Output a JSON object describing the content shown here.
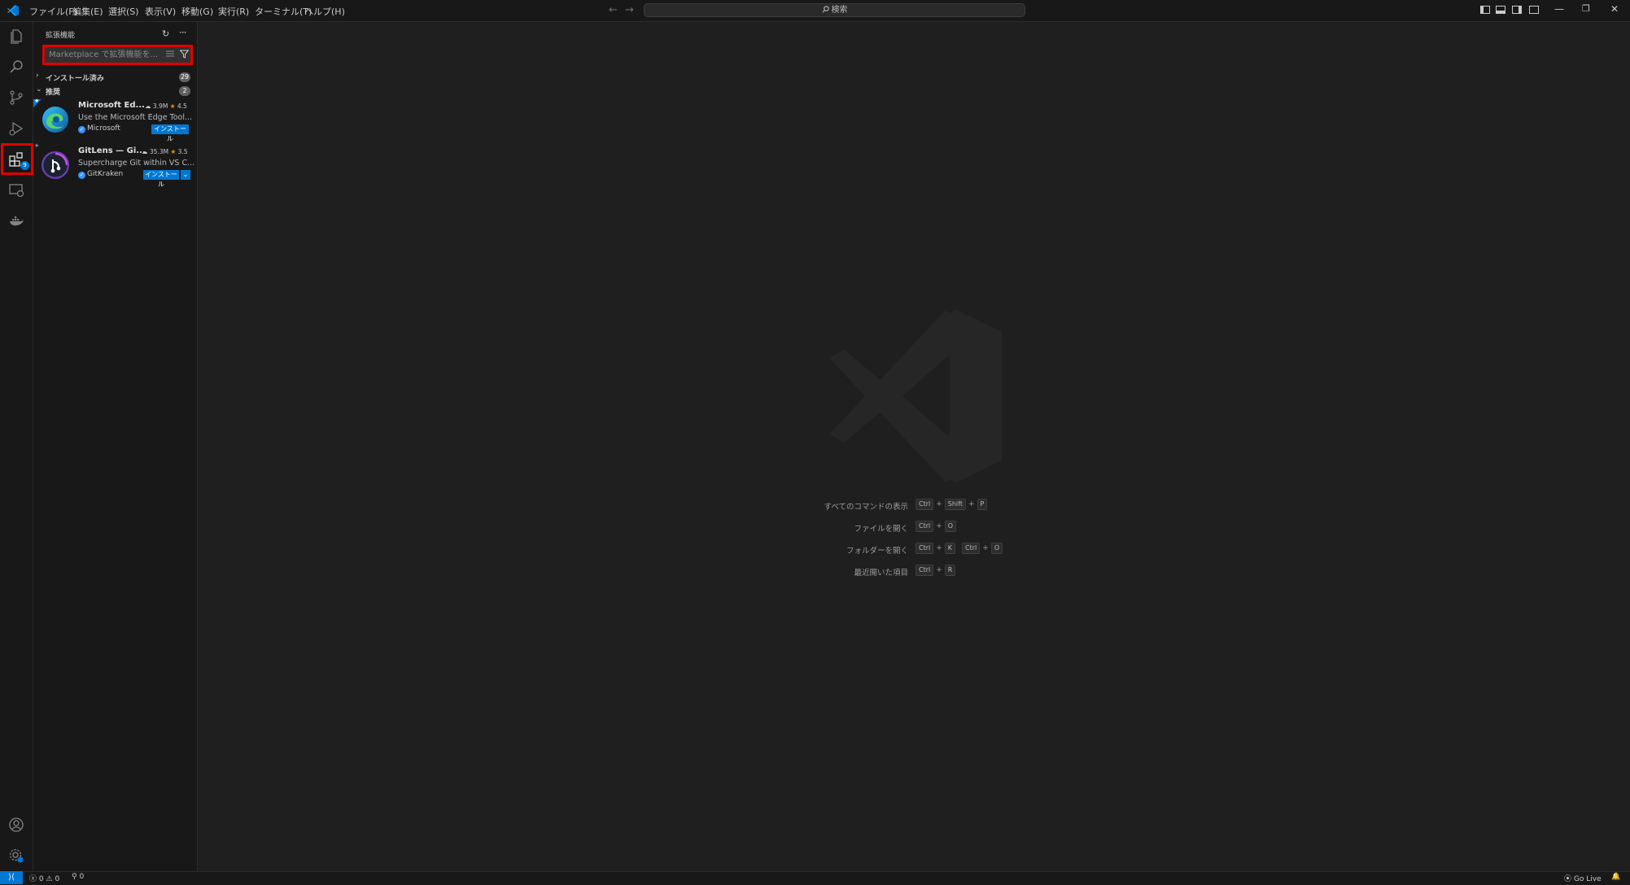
{
  "titlebar": {
    "menu": [
      "ファイル(F)",
      "編集(E)",
      "選択(S)",
      "表示(V)",
      "移動(G)",
      "実行(R)",
      "ターミナル(T)",
      "ヘルプ(H)"
    ],
    "search_label": "検索",
    "nav_back_icon": "arrow-left-icon",
    "nav_forward_icon": "arrow-right-icon"
  },
  "activitybar": {
    "items": [
      "explorer-icon",
      "search-icon",
      "source-control-icon",
      "run-debug-icon",
      "extensions-icon",
      "remote-explorer-icon",
      "docker-icon"
    ],
    "extensions_badge": "9",
    "bottom": [
      "account-icon",
      "manage-gear-icon"
    ]
  },
  "sidebar": {
    "title": "拡張機能",
    "search_placeholder": "Marketplace で拡張機能を...",
    "sections": {
      "installed": {
        "label": "インストール済み",
        "count": "29"
      },
      "recommended": {
        "label": "推奨",
        "count": "2"
      }
    },
    "extensions": [
      {
        "name": "Microsoft Ed...",
        "downloads": "3.9M",
        "rating": "4.5",
        "description": "Use the Microsoft Edge Tool...",
        "publisher": "Microsoft",
        "install_label": "インストール",
        "icon": "edge-icon"
      },
      {
        "name": "GitLens — Gi...",
        "downloads": "35.3M",
        "rating": "3.5",
        "description": "Supercharge Git within VS C...",
        "publisher": "GitKraken",
        "install_label": "インストール",
        "icon": "gitlens-icon"
      }
    ]
  },
  "editor": {
    "shortcuts": [
      {
        "label": "すべてのコマンドの表示",
        "keys": [
          [
            "Ctrl",
            "Shift",
            "P"
          ]
        ]
      },
      {
        "label": "ファイルを開く",
        "keys": [
          [
            "Ctrl",
            "O"
          ]
        ]
      },
      {
        "label": "フォルダーを開く",
        "keys": [
          [
            "Ctrl",
            "K"
          ],
          [
            "Ctrl",
            "O"
          ]
        ]
      },
      {
        "label": "最近開いた項目",
        "keys": [
          [
            "Ctrl",
            "R"
          ]
        ]
      }
    ]
  },
  "statusbar": {
    "errors": "0",
    "warnings": "0",
    "ports": "0",
    "go_live": "Go Live"
  },
  "colors": {
    "accent": "#0078d4",
    "highlight": "#e00000",
    "background": "#1f1f1f",
    "sidebar": "#181818",
    "star": "#ff8e00"
  }
}
